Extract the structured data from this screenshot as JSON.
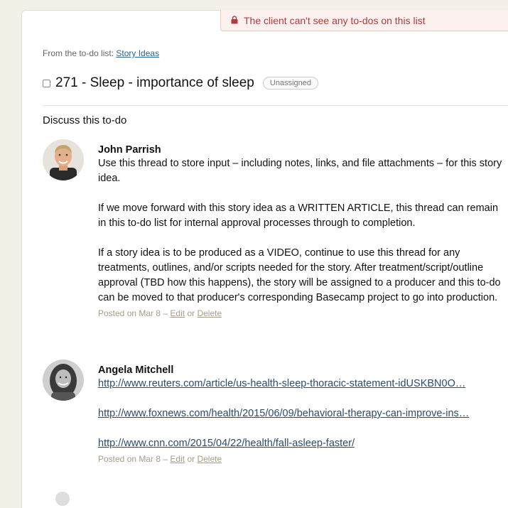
{
  "notice": {
    "text": "The client can't see any to-dos on this list",
    "color": "#b43b3b"
  },
  "source": {
    "prefix": "From the to-do list:",
    "list_name": "Story Ideas"
  },
  "todo": {
    "title": "271 - Sleep - importance of sleep",
    "assignee": "Unassigned",
    "checked": false
  },
  "discussion": {
    "heading": "Discuss this to-do"
  },
  "comments": [
    {
      "author": "John Parrish",
      "avatar": "avatar-john",
      "paragraphs": [
        "Use this thread to store input – including notes, links, and file attachments – for this story idea.",
        "If we move forward with this story idea as a WRITTEN ARTICLE, this thread can remain in this to-do list for internal approval processes through to completion.",
        "If a story idea is to be produced as a VIDEO, continue to use this thread for any treatments, outlines, and/or scripts needed for the story. After treatment/script/outline approval (TBD how this happens), the story will be assigned to a producer and this to-do can be moved to that producer's corresponding Basecamp project to go into production."
      ],
      "meta": {
        "posted": "Posted on Mar 8 –",
        "edit": "Edit",
        "or": "or",
        "delete": "Delete"
      }
    },
    {
      "author": "Angela Mitchell",
      "avatar": "avatar-angela",
      "links": [
        "http://www.reuters.com/article/us-health-sleep-thoracic-statement-idUSKBN0O…",
        "http://www.foxnews.com/health/2015/06/09/behavioral-therapy-can-improve-ins…",
        "http://www.cnn.com/2015/04/22/health/fall-asleep-faster/"
      ],
      "meta": {
        "posted": "Posted on Mar 8 –",
        "edit": "Edit",
        "or": "or",
        "delete": "Delete"
      }
    }
  ]
}
